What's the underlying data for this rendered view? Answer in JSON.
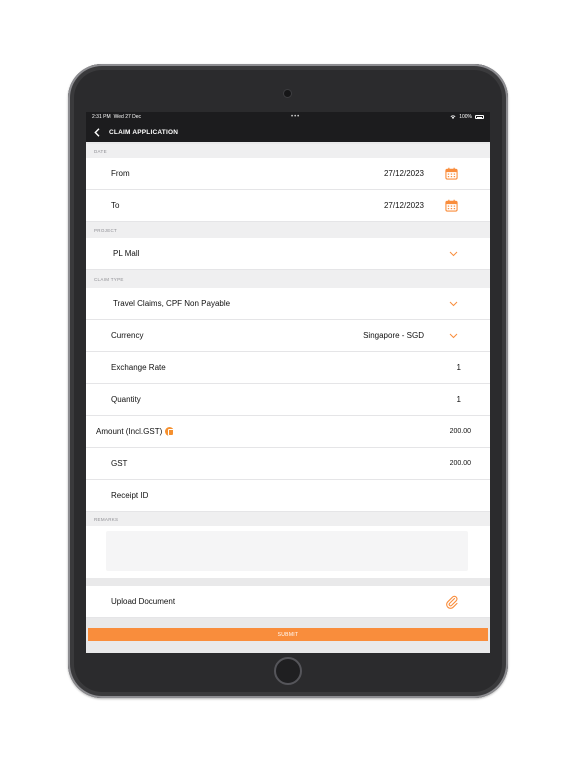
{
  "status_bar": {
    "time": "2:31 PM",
    "date": "Wed 27 Dec",
    "battery": "100%"
  },
  "nav": {
    "title": "CLAIM APPLICATION"
  },
  "sections": {
    "date_label": "DATE",
    "project_label": "PROJECT",
    "claim_type_label": "CLAIM TYPE",
    "remarks_label": "REMARKS"
  },
  "date": {
    "from_label": "From",
    "from_value": "27/12/2023",
    "to_label": "To",
    "to_value": "27/12/2023"
  },
  "project": {
    "value": "PL Mall"
  },
  "claim": {
    "type_value": "Travel Claims, CPF Non Payable",
    "currency_label": "Currency",
    "currency_value": "Singapore - SGD",
    "exchange_label": "Exchange Rate",
    "exchange_value": "1",
    "quantity_label": "Quantity",
    "quantity_value": "1",
    "amount_label": "Amount (Incl.GST)",
    "amount_value": "200.00",
    "gst_label": "GST",
    "gst_value": "200.00",
    "receipt_label": "Receipt ID",
    "receipt_value": ""
  },
  "upload": {
    "label": "Upload Document"
  },
  "submit": {
    "label": "SUBMIT"
  },
  "colors": {
    "accent": "#f98d3c",
    "nav_bg": "#1c1c1e",
    "section_bg": "#efeff0"
  }
}
